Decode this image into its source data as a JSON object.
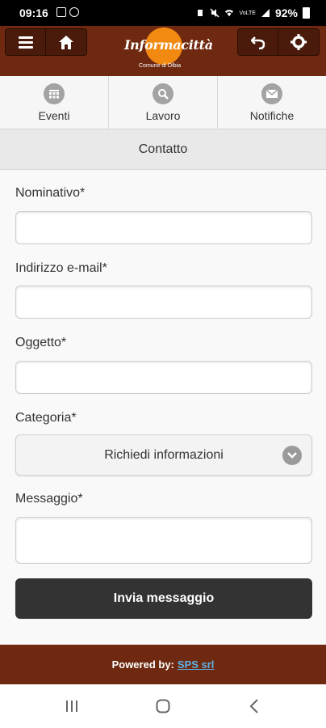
{
  "status": {
    "time": "09:16",
    "battery": "92%",
    "signal_label": "VoLTE"
  },
  "header": {
    "logo_name": "Informacittà",
    "logo_sub": "Comune di Olbia"
  },
  "tabs": [
    {
      "label": "Eventi",
      "icon": "calendar-icon"
    },
    {
      "label": "Lavoro",
      "icon": "search-icon"
    },
    {
      "label": "Notifiche",
      "icon": "mail-icon"
    }
  ],
  "page": {
    "title": "Contatto"
  },
  "form": {
    "name_label": "Nominativo*",
    "name_value": "",
    "email_label": "Indirizzo e-mail*",
    "email_value": "",
    "subject_label": "Oggetto*",
    "subject_value": "",
    "category_label": "Categoria*",
    "category_selected": "Richiedi informazioni",
    "message_label": "Messaggio*",
    "message_value": "",
    "submit_label": "Invia messaggio"
  },
  "footer": {
    "powered_by": "Powered by:",
    "link_text": "SPS srl"
  },
  "colors": {
    "brand": "#6e2910",
    "accent": "#f28a12",
    "button": "#333333",
    "link": "#5bb1e6"
  }
}
